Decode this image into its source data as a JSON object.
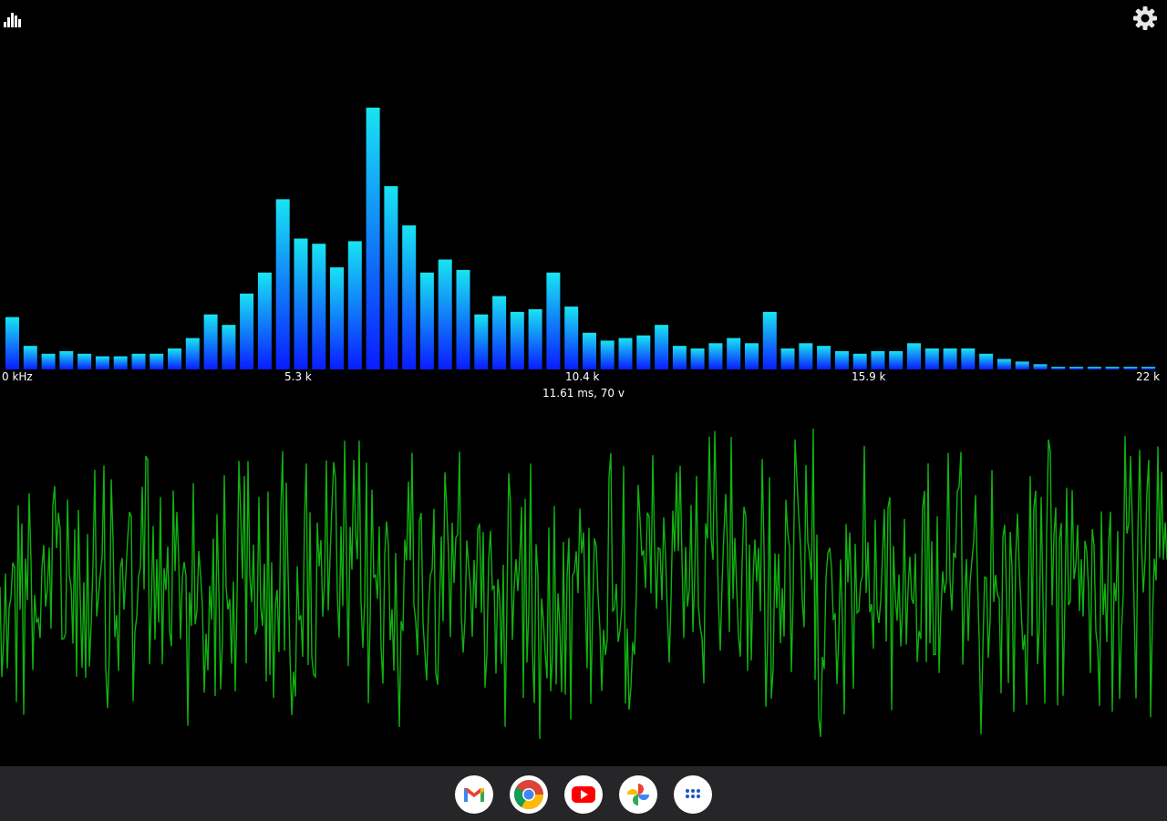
{
  "app": {
    "toolbar": {
      "left_icon": "bar-chart-icon",
      "right_icon": "gear-icon"
    },
    "spectrum": {
      "tick_labels": [
        "0 kHz",
        "5.3 k",
        "10.4 k",
        "15.9 k",
        "22 k"
      ],
      "readout": "11.61 ms, 70 v",
      "colors": {
        "bar_top": "#18e4f2",
        "bar_bottom": "#0a1cff"
      }
    },
    "waveform": {
      "color": "#10b210"
    }
  },
  "chart_data": {
    "type": "bar",
    "xlabel": "",
    "ylabel": "",
    "x_range_khz": [
      0,
      22
    ],
    "x_ticks": [
      "0 kHz",
      "5.3 k",
      "10.4 k",
      "15.9 k",
      "22 k"
    ],
    "values": [
      20,
      9,
      6,
      7,
      6,
      5,
      5,
      6,
      6,
      8,
      12,
      21,
      17,
      29,
      37,
      65,
      50,
      48,
      39,
      49,
      100,
      70,
      55,
      37,
      42,
      38,
      21,
      28,
      22,
      23,
      37,
      24,
      14,
      11,
      12,
      13,
      17,
      9,
      8,
      10,
      12,
      10,
      22,
      8,
      10,
      9,
      7,
      6,
      7,
      7,
      10,
      8,
      8,
      8,
      6,
      4,
      3,
      2,
      1,
      1,
      1,
      1,
      1,
      1
    ]
  },
  "dock": {
    "apps": [
      {
        "name": "gmail",
        "icon": "gmail-icon"
      },
      {
        "name": "chrome",
        "icon": "chrome-icon"
      },
      {
        "name": "youtube",
        "icon": "youtube-icon"
      },
      {
        "name": "photos",
        "icon": "photos-icon"
      },
      {
        "name": "app-drawer",
        "icon": "apps-grid-icon"
      }
    ]
  }
}
